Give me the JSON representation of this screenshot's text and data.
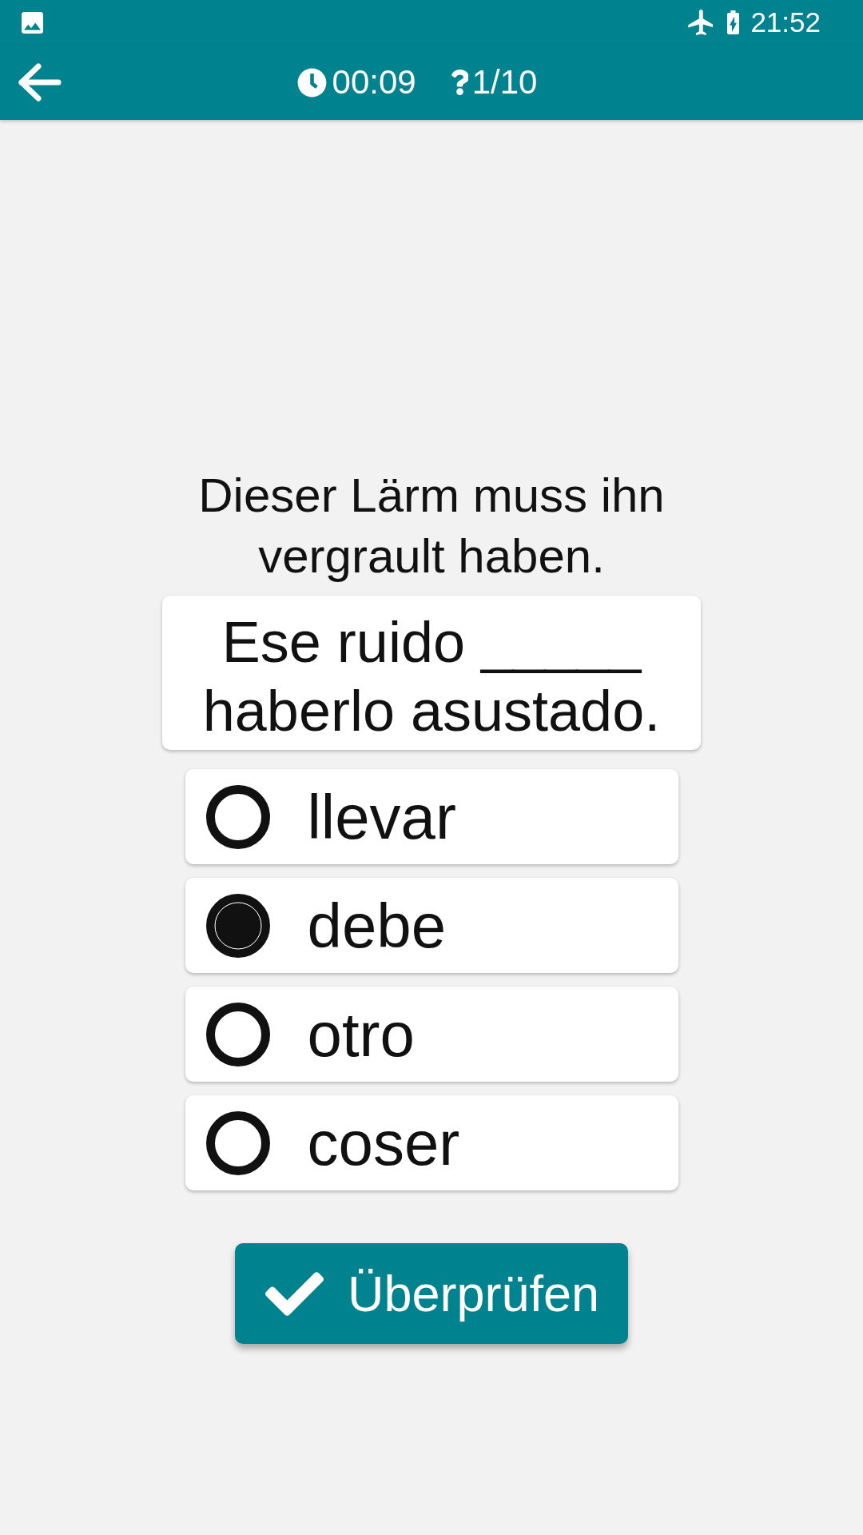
{
  "status_bar": {
    "time": "21:52"
  },
  "app_bar": {
    "timer": "00:09",
    "progress": "1/10"
  },
  "question": {
    "prompt": "Dieser Lärm muss ihn vergrault haben.",
    "sentence": "Ese ruido _____ haberlo asustado."
  },
  "options": [
    {
      "label": "llevar",
      "selected": false
    },
    {
      "label": "debe",
      "selected": true
    },
    {
      "label": "otro",
      "selected": false
    },
    {
      "label": "coser",
      "selected": false
    }
  ],
  "check_button": {
    "label": "Überprüfen"
  }
}
